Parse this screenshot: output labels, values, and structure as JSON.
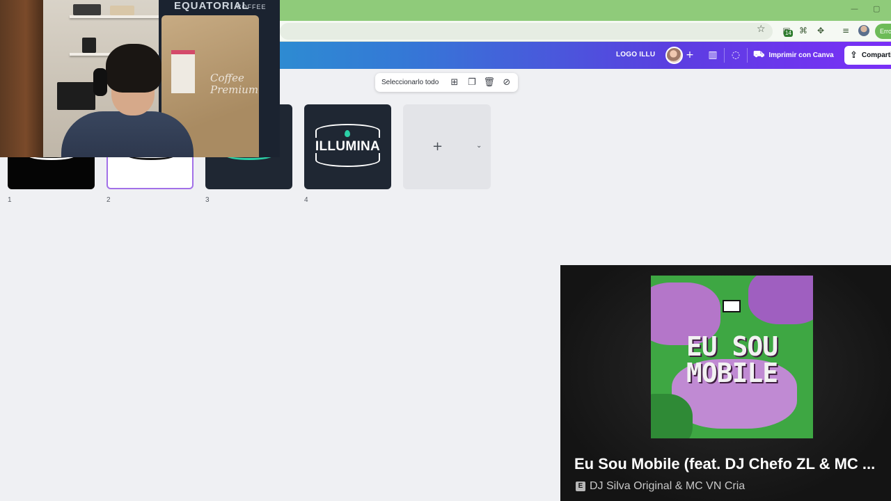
{
  "browser": {
    "window_controls": {
      "minimize": "—",
      "maximize": "▢"
    },
    "profile_pill": "Erro",
    "extension_badge": "14"
  },
  "canva_header": {
    "design_title": "LOGO ILLU",
    "print_label": "Imprimir con Canva",
    "share_label": "Compartir",
    "accent_gradient": [
      "#1fb5c9",
      "#3479d6",
      "#7b2ff7"
    ]
  },
  "selection_toolbar": {
    "select_all_label": "Seleccionarlo todo"
  },
  "pages": [
    {
      "number": "1",
      "style": "black-arc"
    },
    {
      "number": "2",
      "style": "white-arc",
      "selected": true
    },
    {
      "number": "3",
      "style": "dark-teal-arc"
    },
    {
      "number": "4",
      "style": "illumina-logo",
      "logo_text": "ILLUMINA"
    }
  ],
  "add_page": {
    "plus": "+",
    "chevron": "⌄"
  },
  "webcam": {
    "bag_brand": "EQUATORIAL",
    "bag_sub": "COFFEE",
    "bag_script": "Coffee Premium"
  },
  "now_playing": {
    "album_line1": "EU SOU",
    "album_line2": "MOBILE",
    "track_title": "Eu Sou Mobile (feat. DJ Chefo ZL & MC ...",
    "explicit": "E",
    "artists": "DJ Silva Original & MC VN Cria"
  }
}
